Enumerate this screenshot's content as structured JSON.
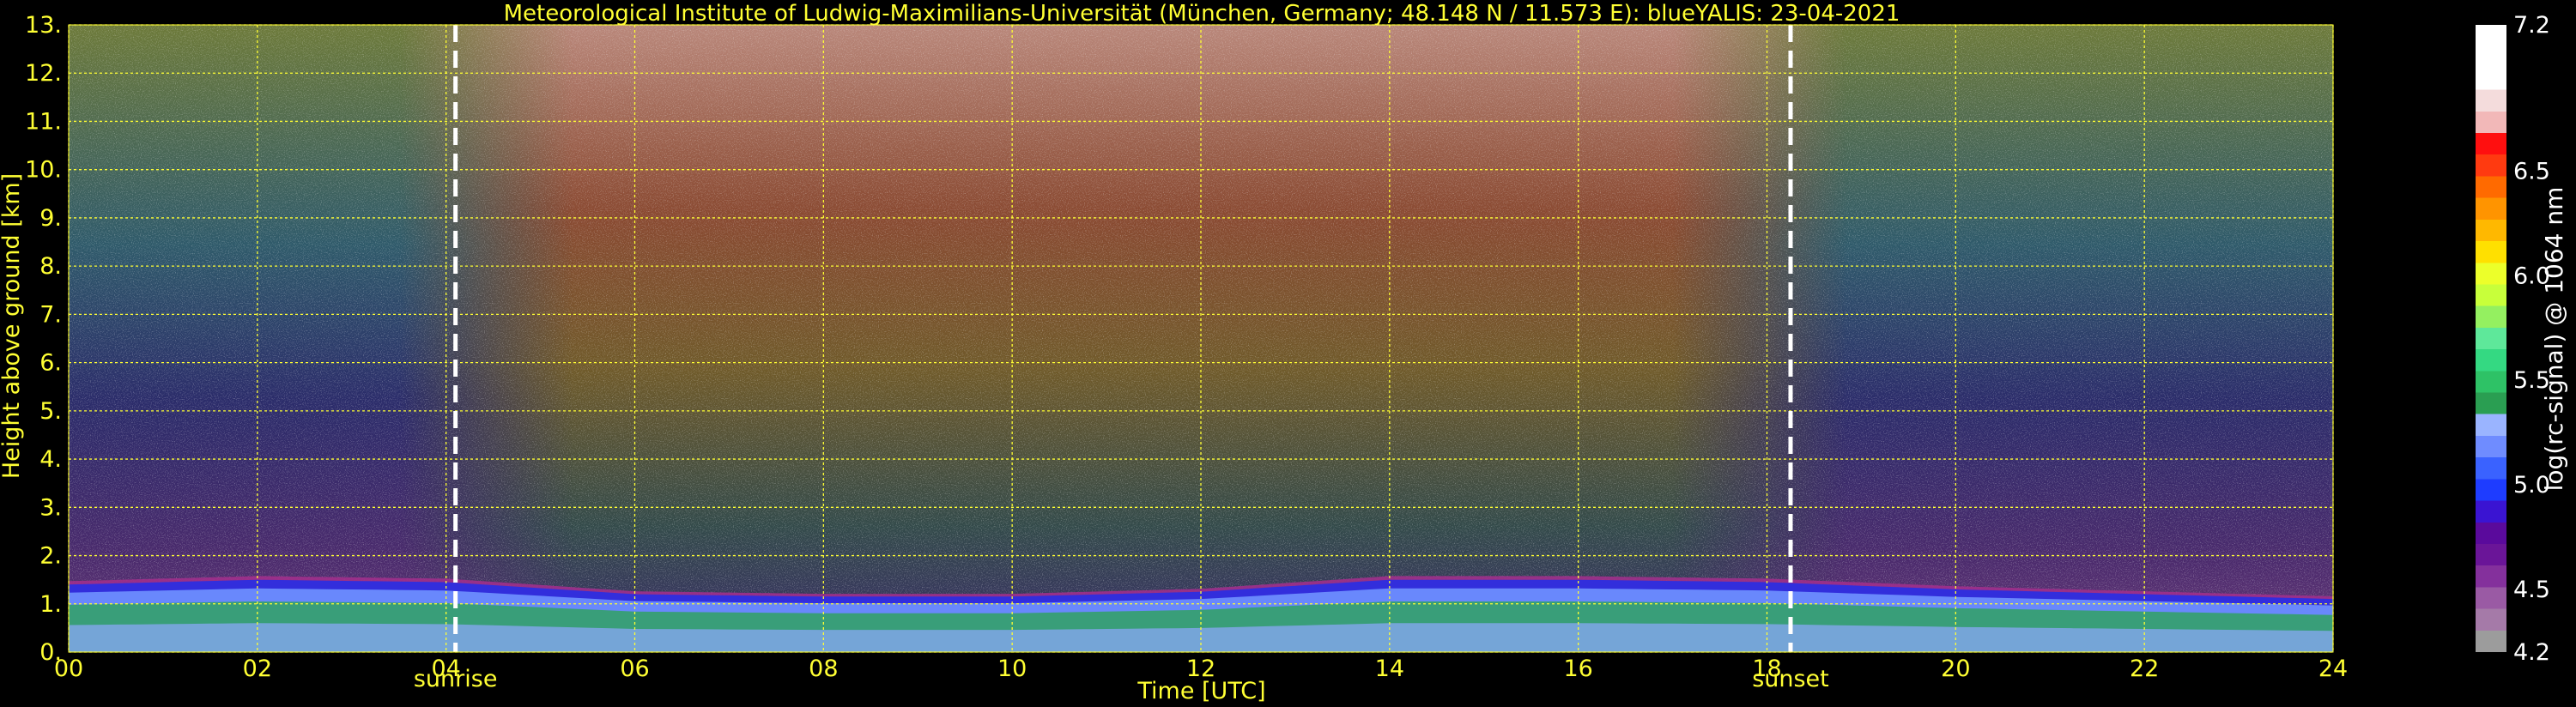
{
  "chart_data": {
    "type": "heatmap",
    "title": "Meteorological Institute of Ludwig-Maximilians-Universität (München, Germany; 48.148 N / 11.573 E):     blueYALIS: 23-04-2021",
    "xlabel": "Time [UTC]",
    "ylabel": "Height above ground [km]",
    "xlim": [
      0,
      24
    ],
    "ylim": [
      0,
      13
    ],
    "x_ticks": [
      0,
      2,
      4,
      6,
      8,
      10,
      12,
      14,
      16,
      18,
      20,
      22,
      24
    ],
    "x_tick_labels": [
      "00",
      "02",
      "04",
      "06",
      "08",
      "10",
      "12",
      "14",
      "16",
      "18",
      "20",
      "22",
      "24"
    ],
    "y_ticks": [
      0,
      1,
      2,
      3,
      4,
      5,
      6,
      7,
      8,
      9,
      10,
      11,
      12,
      13
    ],
    "y_tick_labels": [
      "0.",
      "1.",
      "2.",
      "3.",
      "4.",
      "5.",
      "6.",
      "7.",
      "8.",
      "9.",
      "10.",
      "11.",
      "12.",
      "13."
    ],
    "grid": true,
    "annotations": [
      {
        "text": "sunrise",
        "x": 4.1
      },
      {
        "text": "sunset",
        "x": 18.25
      }
    ],
    "colorbar": {
      "label": "log(rc-signal) @ 1064 nm",
      "range": [
        4.2,
        7.2
      ],
      "tick_values": [
        4.2,
        4.5,
        5.0,
        5.5,
        6.0,
        6.5,
        7.2
      ],
      "tick_labels": [
        "4.2",
        "4.5",
        "5.0",
        "5.5",
        "6.0",
        "6.5",
        "7.2"
      ],
      "colors": [
        "#9c9c9c",
        "#a57aa8",
        "#9a5aa4",
        "#84309c",
        "#6a1598",
        "#5a0a9c",
        "#3a14d2",
        "#1e3cff",
        "#3a62ff",
        "#6f8cff",
        "#9ab4ff",
        "#2a9e52",
        "#2ec266",
        "#34d982",
        "#5ee89a",
        "#94f060",
        "#c8ff3a",
        "#ecff2a",
        "#ffe000",
        "#ffb800",
        "#ff9400",
        "#ff6a00",
        "#ff3a10",
        "#ff0f0f",
        "#f2b8b8",
        "#f4dcdc",
        "#ffffff",
        "#ffffff",
        "#ffffff"
      ]
    },
    "boundary_layer_top_km": [
      [
        0,
        1.4
      ],
      [
        2,
        1.5
      ],
      [
        4,
        1.45
      ],
      [
        6,
        1.2
      ],
      [
        8,
        1.15
      ],
      [
        10,
        1.15
      ],
      [
        12,
        1.25
      ],
      [
        14,
        1.5
      ],
      [
        16,
        1.5
      ],
      [
        18,
        1.45
      ],
      [
        20,
        1.3
      ],
      [
        22,
        1.2
      ],
      [
        24,
        1.1
      ]
    ]
  }
}
